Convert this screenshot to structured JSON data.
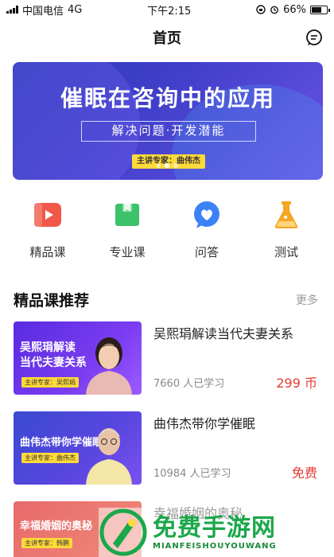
{
  "status_bar": {
    "carrier": "中国电信",
    "network": "4G",
    "time": "下午2:15",
    "battery": "66%",
    "battery_level": 0.66
  },
  "navbar": {
    "title": "首页",
    "message_icon": "chat-bubble-icon"
  },
  "banner": {
    "title": "催眠在咨询中的应用",
    "subtitle": "解决问题·开发潜能",
    "tag": "主讲专家：曲伟杰",
    "pages": 3,
    "active_page": 1
  },
  "categories": [
    {
      "label": "精品课",
      "icon": "video-play-icon",
      "color": "#f0584a"
    },
    {
      "label": "专业课",
      "icon": "book-icon",
      "color": "#3cc26a"
    },
    {
      "label": "问答",
      "icon": "heart-chat-icon",
      "color": "#3b82f6"
    },
    {
      "label": "测试",
      "icon": "flask-icon",
      "color": "#f5a623"
    }
  ],
  "section": {
    "title": "精品课推荐",
    "more": "更多"
  },
  "courses": [
    {
      "title": "吴熙琄解读当代夫妻关系",
      "students": "7660 人已学习",
      "price": "299 币",
      "thumb_text_1": "吴熙琄解读",
      "thumb_text_2": "当代夫妻关系",
      "thumb_chip": "主讲专家：吴熙琄"
    },
    {
      "title": "曲伟杰带你学催眠",
      "students": "10984 人已学习",
      "price": "免费",
      "thumb_text_1": "曲伟杰带你学催眠",
      "thumb_chip": "主讲专家：曲伟杰"
    },
    {
      "title": "幸福婚姻的奥秘",
      "thumb_text_1": "幸福婚姻的奥秘",
      "thumb_chip": "主讲专家：韩鹏"
    }
  ],
  "watermark": {
    "text_cn": "免费手游网",
    "text_en": "MIANFEISHOUYOUWANG"
  },
  "colors": {
    "accent_price": "#e53935",
    "banner_bg": "#3f3fc9"
  }
}
